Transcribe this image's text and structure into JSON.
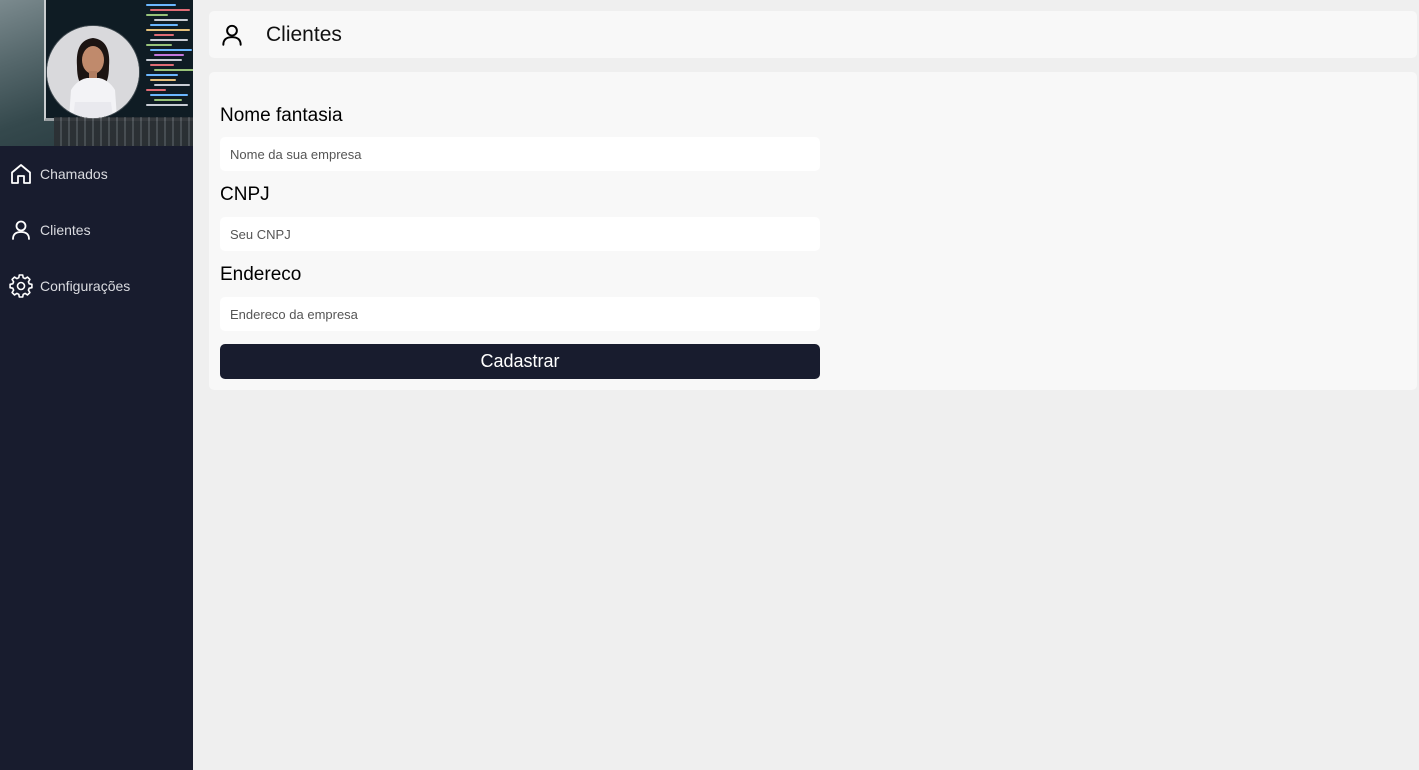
{
  "sidebar": {
    "items": [
      {
        "label": "Chamados",
        "icon": "home-icon"
      },
      {
        "label": "Clientes",
        "icon": "user-icon"
      },
      {
        "label": "Configurações",
        "icon": "gear-icon"
      }
    ]
  },
  "header": {
    "title": "Clientes",
    "icon": "user-icon"
  },
  "form": {
    "fields": [
      {
        "label": "Nome fantasia",
        "placeholder": "Nome da sua empresa",
        "value": ""
      },
      {
        "label": "CNPJ",
        "placeholder": "Seu CNPJ",
        "value": ""
      },
      {
        "label": "Endereco",
        "placeholder": "Endereco da empresa",
        "value": ""
      }
    ],
    "submit_label": "Cadastrar"
  },
  "colors": {
    "sidebar_bg": "#181c2e",
    "page_bg": "#efefef",
    "card_bg": "#f8f8f8",
    "button_bg": "#181c2e",
    "button_text": "#ffffff"
  }
}
